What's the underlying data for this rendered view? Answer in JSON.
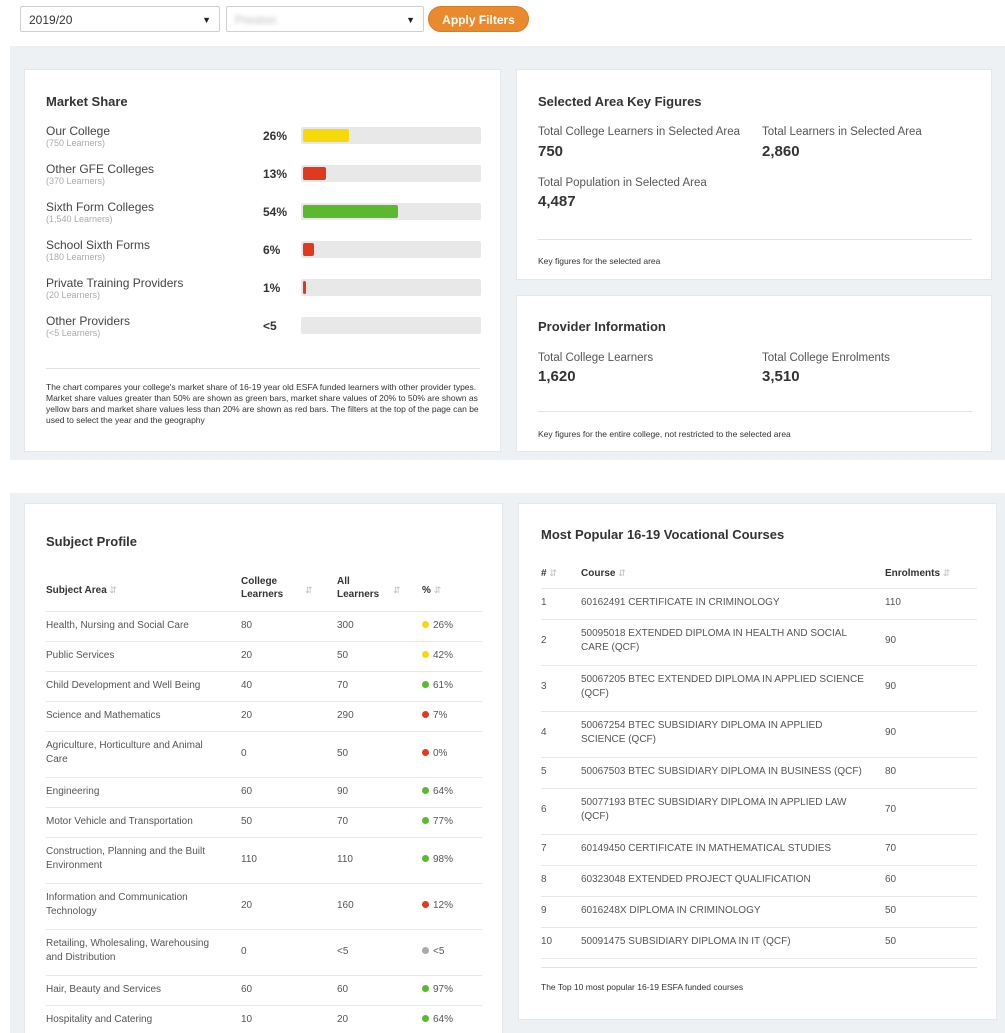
{
  "filters": {
    "year": "2019/20",
    "provider": "Preston",
    "apply_label": "Apply Filters"
  },
  "market_share": {
    "title": "Market Share",
    "rows": [
      {
        "label": "Our College",
        "sub": "(750 Learners)",
        "pct": "26%",
        "value": 26,
        "color": "#f5d90a"
      },
      {
        "label": "Other GFE Colleges",
        "sub": "(370 Learners)",
        "pct": "13%",
        "value": 13,
        "color": "#e03a1e"
      },
      {
        "label": "Sixth Form Colleges",
        "sub": "(1,540 Learners)",
        "pct": "54%",
        "value": 54,
        "color": "#5cb82e"
      },
      {
        "label": "School Sixth Forms",
        "sub": "(180 Learners)",
        "pct": "6%",
        "value": 6,
        "color": "#e03a1e"
      },
      {
        "label": "Private Training Providers",
        "sub": "(20 Learners)",
        "pct": "1%",
        "value": 1,
        "color": "#e03a1e"
      },
      {
        "label": "Other Providers",
        "sub": "(<5 Learners)",
        "pct": "<5",
        "value": 0,
        "color": "#e03a1e"
      }
    ],
    "note": "The chart compares your college's market share of 16-19 year old ESFA funded learners with other provider types. Market share values greater than 50% are shown as green bars, market share values of 20% to 50% are shown as yellow bars and market share values less than 20% are shown as red bars. The filters at the top of the page can be used to select the year and the geography"
  },
  "key_figures": {
    "title": "Selected Area Key Figures",
    "college_learners_label": "Total College Learners in Selected Area",
    "college_learners_value": "750",
    "total_learners_label": "Total Learners in Selected Area",
    "total_learners_value": "2,860",
    "population_label": "Total Population in Selected Area",
    "population_value": "4,487",
    "note": "Key figures for the selected area"
  },
  "provider_info": {
    "title": "Provider Information",
    "learners_label": "Total College Learners",
    "learners_value": "1,620",
    "enrolments_label": "Total College Enrolments",
    "enrolments_value": "3,510",
    "note": "Key figures for the entire college, not restricted to the selected area"
  },
  "subject_profile": {
    "title": "Subject Profile",
    "headers": {
      "subject": "Subject Area",
      "college": "College Learners",
      "all": "All Learners",
      "pct": "%"
    },
    "rows": [
      {
        "subject": "Health, Nursing and Social Care",
        "college": "80",
        "all": "300",
        "pct": "26%",
        "color": "#f5d90a"
      },
      {
        "subject": "Public Services",
        "college": "20",
        "all": "50",
        "pct": "42%",
        "color": "#f5d90a"
      },
      {
        "subject": "Child Development and Well Being",
        "college": "40",
        "all": "70",
        "pct": "61%",
        "color": "#5cb82e"
      },
      {
        "subject": "Science and Mathematics",
        "college": "20",
        "all": "290",
        "pct": "7%",
        "color": "#e03a1e"
      },
      {
        "subject": "Agriculture, Horticulture and Animal Care",
        "college": "0",
        "all": "50",
        "pct": "0%",
        "color": "#e03a1e"
      },
      {
        "subject": "Engineering",
        "college": "60",
        "all": "90",
        "pct": "64%",
        "color": "#5cb82e"
      },
      {
        "subject": "Motor Vehicle and Transportation",
        "college": "50",
        "all": "70",
        "pct": "77%",
        "color": "#5cb82e"
      },
      {
        "subject": "Construction, Planning and the Built Environment",
        "college": "110",
        "all": "110",
        "pct": "98%",
        "color": "#5cb82e"
      },
      {
        "subject": "Information and Communication Technology",
        "college": "20",
        "all": "160",
        "pct": "12%",
        "color": "#e03a1e"
      },
      {
        "subject": "Retailing, Wholesaling, Warehousing and Distribution",
        "college": "0",
        "all": "<5",
        "pct": "<5",
        "color": "#aaaaaa"
      },
      {
        "subject": "Hair, Beauty and Services",
        "college": "60",
        "all": "60",
        "pct": "97%",
        "color": "#5cb82e"
      },
      {
        "subject": "Hospitality and Catering",
        "college": "10",
        "all": "20",
        "pct": "64%",
        "color": "#5cb82e"
      }
    ]
  },
  "courses": {
    "title": "Most Popular 16-19 Vocational Courses",
    "headers": {
      "num": "#",
      "course": "Course",
      "enrolments": "Enrolments"
    },
    "rows": [
      {
        "num": "1",
        "course": "60162491 CERTIFICATE IN CRIMINOLOGY",
        "enrolments": "110"
      },
      {
        "num": "2",
        "course": "50095018 EXTENDED DIPLOMA IN HEALTH AND SOCIAL CARE (QCF)",
        "enrolments": "90"
      },
      {
        "num": "3",
        "course": "50067205 BTEC EXTENDED DIPLOMA IN APPLIED SCIENCE (QCF)",
        "enrolments": "90"
      },
      {
        "num": "4",
        "course": "50067254 BTEC SUBSIDIARY DIPLOMA IN APPLIED SCIENCE (QCF)",
        "enrolments": "90"
      },
      {
        "num": "5",
        "course": "50067503 BTEC SUBSIDIARY DIPLOMA IN BUSINESS (QCF)",
        "enrolments": "80"
      },
      {
        "num": "6",
        "course": "50077193 BTEC SUBSIDIARY DIPLOMA IN APPLIED LAW (QCF)",
        "enrolments": "70"
      },
      {
        "num": "7",
        "course": "60149450 CERTIFICATE IN MATHEMATICAL STUDIES",
        "enrolments": "70"
      },
      {
        "num": "8",
        "course": "60323048 EXTENDED PROJECT QUALIFICATION",
        "enrolments": "60"
      },
      {
        "num": "9",
        "course": "6016248X DIPLOMA IN CRIMINOLOGY",
        "enrolments": "50"
      },
      {
        "num": "10",
        "course": "50091475 SUBSIDIARY DIPLOMA IN IT (QCF)",
        "enrolments": "50"
      }
    ],
    "note": "The Top 10 most popular 16-19 ESFA funded courses"
  }
}
